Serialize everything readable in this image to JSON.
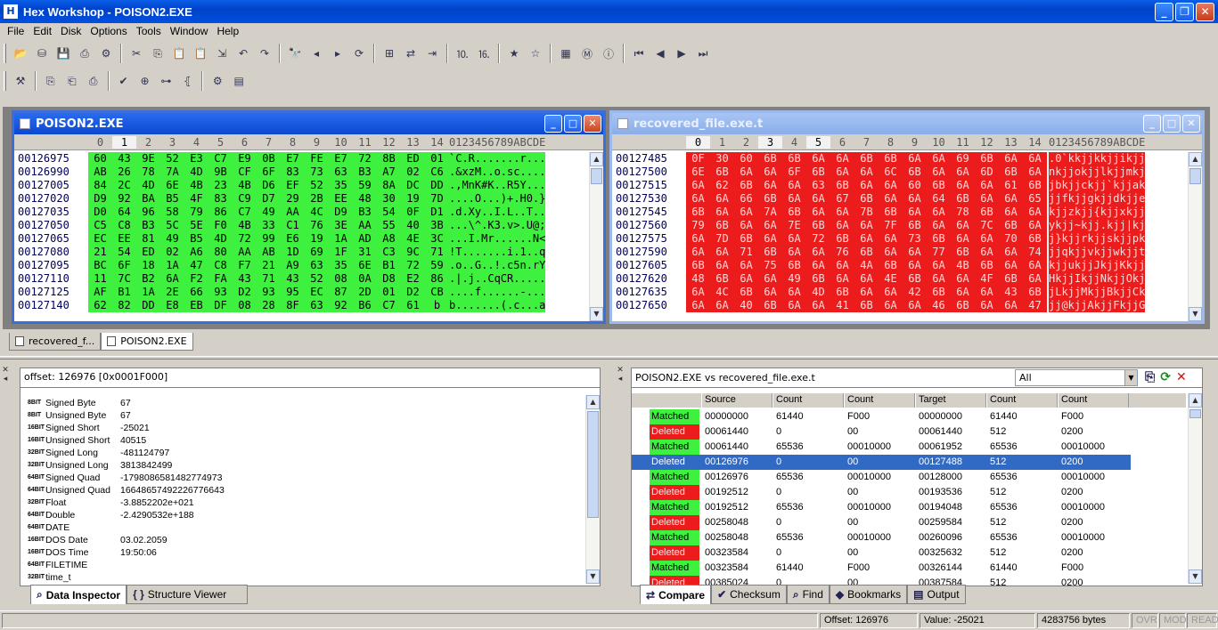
{
  "app": {
    "title": "Hex Workshop - POISON2.EXE",
    "icon": "H"
  },
  "menu": [
    "File",
    "Edit",
    "Disk",
    "Options",
    "Tools",
    "Window",
    "Help"
  ],
  "hex_left": {
    "title": "POISON2.EXE",
    "columns": [
      "0",
      "1",
      "2",
      "3",
      "4",
      "5",
      "6",
      "7",
      "8",
      "9",
      "10",
      "11",
      "12",
      "13",
      "14"
    ],
    "ascii_header": "0123456789ABCDE",
    "rows": [
      {
        "offset": "00126975",
        "bytes": [
          "60",
          "43",
          "9E",
          "52",
          "E3",
          "C7",
          "E9",
          "0B",
          "E7",
          "FE",
          "E7",
          "72",
          "8B",
          "ED",
          "01"
        ],
        "ascii": "`C.R.......r..."
      },
      {
        "offset": "00126990",
        "bytes": [
          "AB",
          "26",
          "78",
          "7A",
          "4D",
          "9B",
          "CF",
          "6F",
          "83",
          "73",
          "63",
          "B3",
          "A7",
          "02",
          "C6"
        ],
        "ascii": ".&xzM..o.sc...."
      },
      {
        "offset": "00127005",
        "bytes": [
          "84",
          "2C",
          "4D",
          "6E",
          "4B",
          "23",
          "4B",
          "D6",
          "EF",
          "52",
          "35",
          "59",
          "8A",
          "DC",
          "DD"
        ],
        "ascii": ".,MnK#K..R5Y..."
      },
      {
        "offset": "00127020",
        "bytes": [
          "D9",
          "92",
          "BA",
          "B5",
          "4F",
          "83",
          "C9",
          "D7",
          "29",
          "2B",
          "EE",
          "48",
          "30",
          "19",
          "7D"
        ],
        "ascii": "....O...)+.H0.}"
      },
      {
        "offset": "00127035",
        "bytes": [
          "D0",
          "64",
          "96",
          "58",
          "79",
          "86",
          "C7",
          "49",
          "AA",
          "4C",
          "D9",
          "B3",
          "54",
          "0F",
          "D1"
        ],
        "ascii": ".d.Xy..I.L..T.."
      },
      {
        "offset": "00127050",
        "bytes": [
          "C5",
          "C8",
          "B3",
          "5C",
          "5E",
          "F0",
          "4B",
          "33",
          "C1",
          "76",
          "3E",
          "AA",
          "55",
          "40",
          "3B"
        ],
        "ascii": "...\\^.K3.v>.U@;"
      },
      {
        "offset": "00127065",
        "bytes": [
          "EC",
          "EE",
          "81",
          "49",
          "B5",
          "4D",
          "72",
          "99",
          "E6",
          "19",
          "1A",
          "AD",
          "A8",
          "4E",
          "3C"
        ],
        "ascii": "...I.Mr......N<"
      },
      {
        "offset": "00127080",
        "bytes": [
          "21",
          "54",
          "ED",
          "02",
          "A6",
          "80",
          "AA",
          "AB",
          "1D",
          "69",
          "1F",
          "31",
          "C3",
          "9C",
          "71"
        ],
        "ascii": "!T.......i.1..q"
      },
      {
        "offset": "00127095",
        "bytes": [
          "BC",
          "6F",
          "18",
          "1A",
          "47",
          "C8",
          "F7",
          "21",
          "A9",
          "63",
          "35",
          "6E",
          "B1",
          "72",
          "59"
        ],
        "ascii": ".o..G..!.c5n.rY"
      },
      {
        "offset": "00127110",
        "bytes": [
          "11",
          "7C",
          "B2",
          "6A",
          "F2",
          "FA",
          "43",
          "71",
          "43",
          "52",
          "08",
          "0A",
          "D8",
          "E2",
          "86"
        ],
        "ascii": ".|.j..CqCR....."
      },
      {
        "offset": "00127125",
        "bytes": [
          "AF",
          "B1",
          "1A",
          "2E",
          "66",
          "93",
          "D2",
          "93",
          "95",
          "EC",
          "87",
          "2D",
          "01",
          "D2",
          "CB"
        ],
        "ascii": "....f......-..."
      },
      {
        "offset": "00127140",
        "bytes": [
          "62",
          "82",
          "DD",
          "E8",
          "EB",
          "DF",
          "08",
          "28",
          "8F",
          "63",
          "92",
          "B6",
          "C7",
          "61",
          "b"
        ],
        "ascii": "b.......(.c...a"
      }
    ]
  },
  "hex_right": {
    "title": "recovered_file.exe.t",
    "columns": [
      "0",
      "1",
      "2",
      "3",
      "4",
      "5",
      "6",
      "7",
      "8",
      "9",
      "10",
      "11",
      "12",
      "13",
      "14"
    ],
    "ascii_header": "0123456789ABCDE",
    "rows": [
      {
        "offset": "00127485",
        "bytes": [
          "0F",
          "30",
          "60",
          "6B",
          "6B",
          "6A",
          "6A",
          "6B",
          "6B",
          "6A",
          "6A",
          "69",
          "6B",
          "6A",
          "6A"
        ],
        "ascii": ".0`kkjjkkjjikjj"
      },
      {
        "offset": "00127500",
        "bytes": [
          "6E",
          "6B",
          "6A",
          "6A",
          "6F",
          "6B",
          "6A",
          "6A",
          "6C",
          "6B",
          "6A",
          "6A",
          "6D",
          "6B",
          "6A"
        ],
        "ascii": "nkjjokjjlkjjmkj"
      },
      {
        "offset": "00127515",
        "bytes": [
          "6A",
          "62",
          "6B",
          "6A",
          "6A",
          "63",
          "6B",
          "6A",
          "6A",
          "60",
          "6B",
          "6A",
          "6A",
          "61",
          "6B"
        ],
        "ascii": "jbkjjckjj`kjjak"
      },
      {
        "offset": "00127530",
        "bytes": [
          "6A",
          "6A",
          "66",
          "6B",
          "6A",
          "6A",
          "67",
          "6B",
          "6A",
          "6A",
          "64",
          "6B",
          "6A",
          "6A",
          "65"
        ],
        "ascii": "jjfkjjgkjjdkjje"
      },
      {
        "offset": "00127545",
        "bytes": [
          "6B",
          "6A",
          "6A",
          "7A",
          "6B",
          "6A",
          "6A",
          "7B",
          "6B",
          "6A",
          "6A",
          "78",
          "6B",
          "6A",
          "6A"
        ],
        "ascii": "kjjzkjj{kjjxkjj"
      },
      {
        "offset": "00127560",
        "bytes": [
          "79",
          "6B",
          "6A",
          "6A",
          "7E",
          "6B",
          "6A",
          "6A",
          "7F",
          "6B",
          "6A",
          "6A",
          "7C",
          "6B",
          "6A"
        ],
        "ascii": "ykjj~kjj.kjj|kj"
      },
      {
        "offset": "00127575",
        "bytes": [
          "6A",
          "7D",
          "6B",
          "6A",
          "6A",
          "72",
          "6B",
          "6A",
          "6A",
          "73",
          "6B",
          "6A",
          "6A",
          "70",
          "6B"
        ],
        "ascii": "j}kjjrkjjskjjpk"
      },
      {
        "offset": "00127590",
        "bytes": [
          "6A",
          "6A",
          "71",
          "6B",
          "6A",
          "6A",
          "76",
          "6B",
          "6A",
          "6A",
          "77",
          "6B",
          "6A",
          "6A",
          "74"
        ],
        "ascii": "jjqkjjvkjjwkjjt"
      },
      {
        "offset": "00127605",
        "bytes": [
          "6B",
          "6A",
          "6A",
          "75",
          "6B",
          "6A",
          "6A",
          "4A",
          "6B",
          "6A",
          "6A",
          "4B",
          "6B",
          "6A",
          "6A"
        ],
        "ascii": "kjjukjjJkjjKkjj"
      },
      {
        "offset": "00127620",
        "bytes": [
          "48",
          "6B",
          "6A",
          "6A",
          "49",
          "6B",
          "6A",
          "6A",
          "4E",
          "6B",
          "6A",
          "6A",
          "4F",
          "6B",
          "6A"
        ],
        "ascii": "HkjjIkjjNkjjOkj"
      },
      {
        "offset": "00127635",
        "bytes": [
          "6A",
          "4C",
          "6B",
          "6A",
          "6A",
          "4D",
          "6B",
          "6A",
          "6A",
          "42",
          "6B",
          "6A",
          "6A",
          "43",
          "6B"
        ],
        "ascii": "jLkjjMkjjBkjjCk"
      },
      {
        "offset": "00127650",
        "bytes": [
          "6A",
          "6A",
          "40",
          "6B",
          "6A",
          "6A",
          "41",
          "6B",
          "6A",
          "6A",
          "46",
          "6B",
          "6A",
          "6A",
          "47"
        ],
        "ascii": "jj@kjjAkjjFkjjG"
      }
    ]
  },
  "doc_tabs": [
    "recovered_f...",
    "POISON2.EXE"
  ],
  "inspector": {
    "offset_text": "offset: 126976 [0x0001F000]",
    "rows": [
      {
        "bits": "8BIT",
        "label": "Signed Byte",
        "value": "67"
      },
      {
        "bits": "8BIT",
        "label": "Unsigned Byte",
        "value": "67"
      },
      {
        "bits": "16BIT",
        "label": "Signed Short",
        "value": "-25021"
      },
      {
        "bits": "16BIT",
        "label": "Unsigned Short",
        "value": "40515"
      },
      {
        "bits": "32BIT",
        "label": "Signed Long",
        "value": "-481124797"
      },
      {
        "bits": "32BIT",
        "label": "Unsigned Long",
        "value": "3813842499"
      },
      {
        "bits": "64BIT",
        "label": "Signed Quad",
        "value": "-1798086581482774973"
      },
      {
        "bits": "64BIT",
        "label": "Unsigned Quad",
        "value": "16648657492226776643"
      },
      {
        "bits": "32BIT",
        "label": "Float",
        "value": "-3.8852202e+021"
      },
      {
        "bits": "64BIT",
        "label": "Double",
        "value": "-2.4290532e+188"
      },
      {
        "bits": "64BIT",
        "label": "DATE",
        "value": ""
      },
      {
        "bits": "16BIT",
        "label": "DOS Date",
        "value": "03.02.2059"
      },
      {
        "bits": "16BIT",
        "label": "DOS Time",
        "value": "19:50:06"
      },
      {
        "bits": "64BIT",
        "label": "FILETIME",
        "value": ""
      },
      {
        "bits": "32BIT",
        "label": "time_t",
        "value": ""
      }
    ],
    "tabs": [
      "Data Inspector",
      "Structure Viewer"
    ]
  },
  "compare": {
    "title": "POISON2.EXE vs recovered_file.exe.t",
    "filter": "All",
    "headers": [
      "Source",
      "Count",
      "Count",
      "Target",
      "Count",
      "Count"
    ],
    "rows": [
      {
        "status": "Matched",
        "src": "00000000",
        "c1": "61440",
        "c2": "F000",
        "tgt": "00000000",
        "c3": "61440",
        "c4": "F000"
      },
      {
        "status": "Deleted",
        "src": "00061440",
        "c1": "0",
        "c2": "00",
        "tgt": "00061440",
        "c3": "512",
        "c4": "0200"
      },
      {
        "status": "Matched",
        "src": "00061440",
        "c1": "65536",
        "c2": "00010000",
        "tgt": "00061952",
        "c3": "65536",
        "c4": "00010000"
      },
      {
        "status": "Deleted",
        "src": "00126976",
        "c1": "0",
        "c2": "00",
        "tgt": "00127488",
        "c3": "512",
        "c4": "0200"
      },
      {
        "status": "Matched",
        "src": "00126976",
        "c1": "65536",
        "c2": "00010000",
        "tgt": "00128000",
        "c3": "65536",
        "c4": "00010000"
      },
      {
        "status": "Deleted",
        "src": "00192512",
        "c1": "0",
        "c2": "00",
        "tgt": "00193536",
        "c3": "512",
        "c4": "0200"
      },
      {
        "status": "Matched",
        "src": "00192512",
        "c1": "65536",
        "c2": "00010000",
        "tgt": "00194048",
        "c3": "65536",
        "c4": "00010000"
      },
      {
        "status": "Deleted",
        "src": "00258048",
        "c1": "0",
        "c2": "00",
        "tgt": "00259584",
        "c3": "512",
        "c4": "0200"
      },
      {
        "status": "Matched",
        "src": "00258048",
        "c1": "65536",
        "c2": "00010000",
        "tgt": "00260096",
        "c3": "65536",
        "c4": "00010000"
      },
      {
        "status": "Deleted",
        "src": "00323584",
        "c1": "0",
        "c2": "00",
        "tgt": "00325632",
        "c3": "512",
        "c4": "0200"
      },
      {
        "status": "Matched",
        "src": "00323584",
        "c1": "61440",
        "c2": "F000",
        "tgt": "00326144",
        "c3": "61440",
        "c4": "F000"
      },
      {
        "status": "Deleted",
        "src": "00385024",
        "c1": "0",
        "c2": "00",
        "tgt": "00387584",
        "c3": "512",
        "c4": "0200"
      }
    ],
    "selected_index": 3,
    "tabs": [
      "Compare",
      "Checksum",
      "Find",
      "Bookmarks",
      "Output"
    ]
  },
  "status": {
    "offset": "Offset: 126976",
    "value": "Value: -25021",
    "size": "4283756 bytes",
    "ovr": "OVR",
    "mod": "MOD",
    "read": "READ"
  }
}
